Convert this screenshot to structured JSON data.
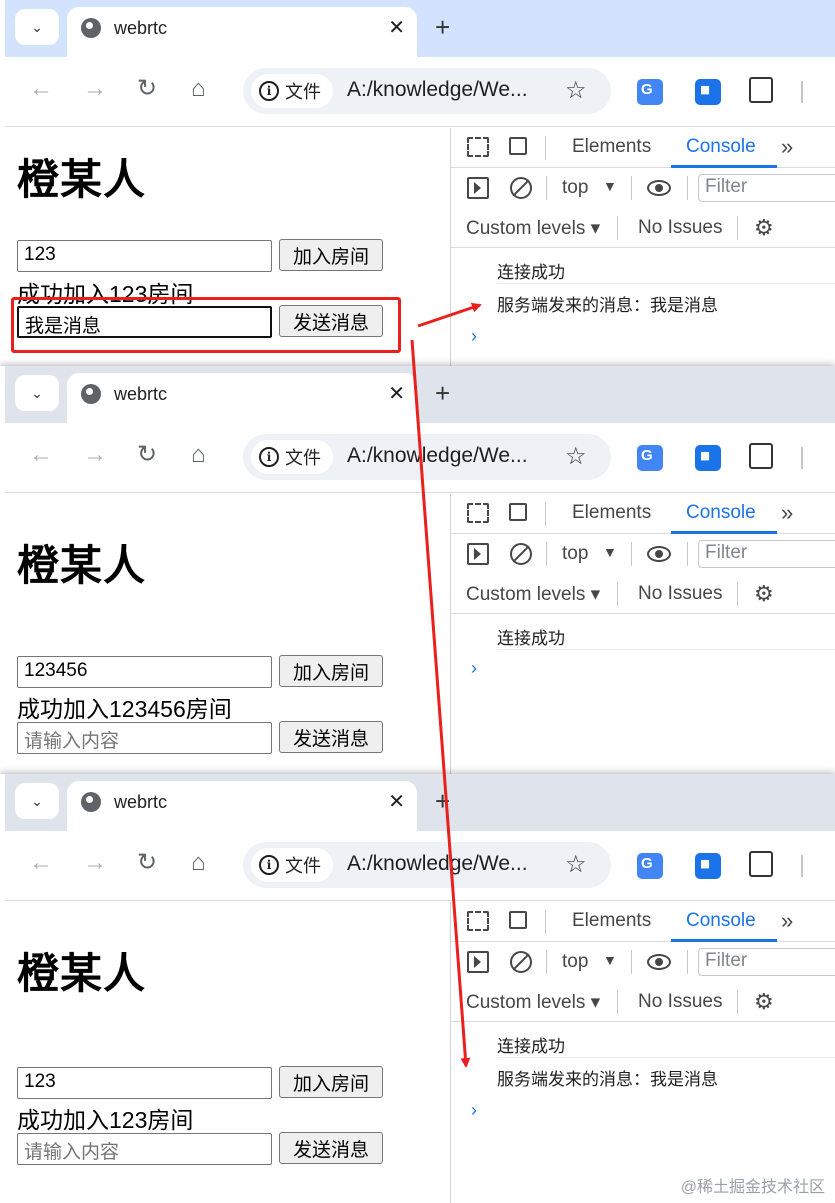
{
  "windows": [
    {
      "tab_title": "webrtc",
      "chip_label": "文件",
      "url": "A:/knowledge/We...",
      "heading": "橙某人",
      "room_value": "123",
      "join_label": "加入房间",
      "status": "成功加入123房间",
      "message_value": "我是消息",
      "send_label": "发送消息",
      "console": [
        "连接成功",
        "服务端发来的消息：我是消息"
      ]
    },
    {
      "tab_title": "webrtc",
      "chip_label": "文件",
      "url": "A:/knowledge/We...",
      "heading": "橙某人",
      "room_value": "123456",
      "join_label": "加入房间",
      "status": "成功加入123456房间",
      "message_placeholder": "请输入内容",
      "send_label": "发送消息",
      "console": [
        "连接成功"
      ]
    },
    {
      "tab_title": "webrtc",
      "chip_label": "文件",
      "url": "A:/knowledge/We...",
      "heading": "橙某人",
      "room_value": "123",
      "join_label": "加入房间",
      "status": "成功加入123房间",
      "message_placeholder": "请输入内容",
      "send_label": "发送消息",
      "console": [
        "连接成功",
        "服务端发来的消息：我是消息"
      ]
    }
  ],
  "devtools": {
    "tab_elements": "Elements",
    "tab_console": "Console",
    "more": "»",
    "context": "top",
    "filter_placeholder": "Filter",
    "levels": "Custom levels ▾",
    "issues": "No Issues"
  },
  "icons": {
    "new_tab": "+",
    "close": "✕",
    "back": "←",
    "forward": "→",
    "reload": "↻",
    "home": "⌂",
    "star": "☆",
    "menu": "⋮",
    "tab_search": "⌄",
    "prompt": "›",
    "gear": "⚙"
  },
  "colors": {
    "accent": "#1a73e8",
    "annotation": "#e9201d",
    "active_tabstrip": "#d3e3fd",
    "inactive_tabstrip": "#dfe3eb"
  },
  "watermark": "@稀土掘金技术社区"
}
